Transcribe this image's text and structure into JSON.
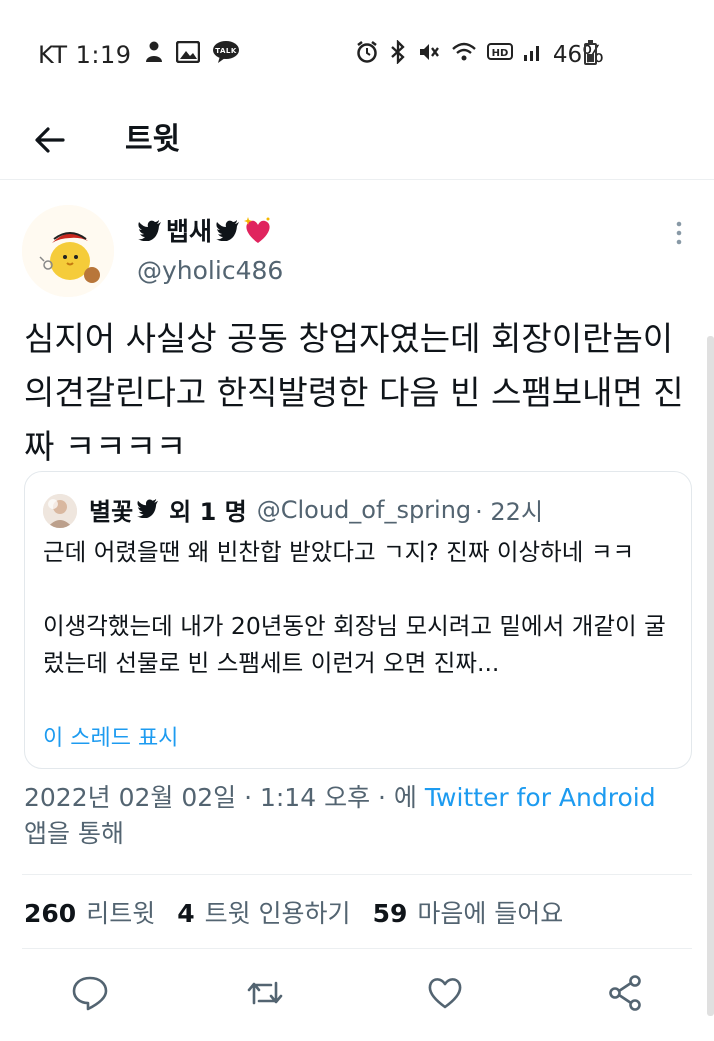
{
  "status_bar": {
    "carrier_time": "KT 1:19",
    "battery": "46%",
    "hd_label": "HD",
    "talk_label": "TALK",
    "left_icons": [
      "person-icon",
      "gallery-icon",
      "talk-icon"
    ],
    "right_icons": [
      "alarm-icon",
      "bluetooth-icon",
      "mute-icon",
      "wifi-icon",
      "signal-icon",
      "battery-icon"
    ]
  },
  "header": {
    "title": "트윗"
  },
  "tweet": {
    "display_name": "뱁새",
    "handle": "@yholic486",
    "text": "심지어 사실상 공동 창업자였는데 회장이란놈이 의견갈린다고 한직발령한 다음 빈 스팸보내면 진짜 ㅋㅋㅋㅋ",
    "meta_date": "2022년 02월 02일 · 1:14 오후 · 에 ",
    "meta_source": "Twitter for Android",
    "meta_suffix": "앱을 통해"
  },
  "quote": {
    "name": "별꽃",
    "others": "외 1 명",
    "handle": "@Cloud_of_spring",
    "time": "· 22시",
    "body": "근데 어렸을땐 왜 빈찬합 받았다고 ㄱ지? 진짜 이상하네 ㅋㅋ\n\n이생각했는데 내가 20년동안 회장님 모시려고 밑에서 개같이 굴렀는데 선물로 빈 스팸세트 이런거 오면 진짜...",
    "show_thread": "이 스레드 표시"
  },
  "stats": {
    "retweets_count": "260",
    "retweets_label": "리트윗",
    "quotes_count": "4",
    "quotes_label": "트윗 인용하기",
    "likes_count": "59",
    "likes_label": "마음에 들어요"
  },
  "actions": [
    "reply-icon",
    "retweet-icon",
    "like-icon",
    "share-icon"
  ],
  "colors": {
    "accent": "#1d9bf0",
    "secondary_text": "#536471",
    "heart": "#e0245e"
  }
}
